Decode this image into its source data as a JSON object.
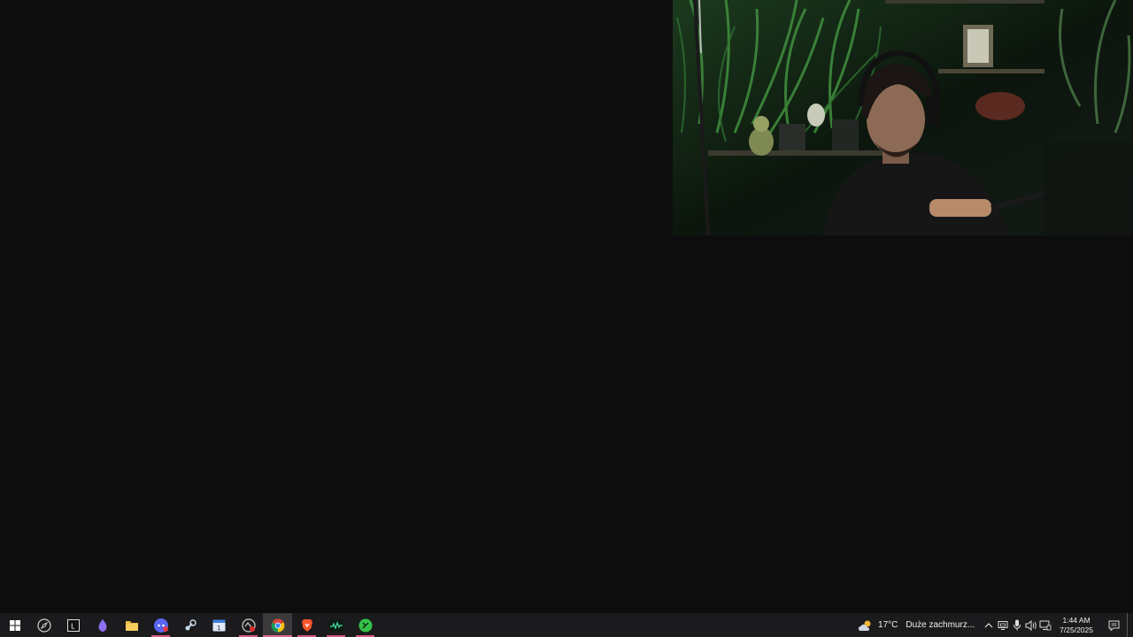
{
  "taskbar": {
    "apps": [
      {
        "name": "start-button",
        "icon": "windows-logo-icon",
        "active": false,
        "running": false
      },
      {
        "name": "taskbar-app-widget",
        "icon": "compass-icon",
        "active": false,
        "running": false
      },
      {
        "name": "taskbar-app-terminal",
        "icon": "terminal-icon",
        "active": false,
        "running": false
      },
      {
        "name": "taskbar-app-purple-drop",
        "icon": "drop-icon",
        "active": false,
        "running": false
      },
      {
        "name": "taskbar-app-file-explorer",
        "icon": "folder-icon",
        "active": false,
        "running": false
      },
      {
        "name": "taskbar-app-discord",
        "icon": "discord-icon",
        "active": false,
        "running": true
      },
      {
        "name": "taskbar-app-steam",
        "icon": "steam-icon",
        "active": false,
        "running": false
      },
      {
        "name": "taskbar-app-calendar",
        "icon": "calendar-icon",
        "active": false,
        "running": false
      },
      {
        "name": "taskbar-app-recorder",
        "icon": "recorder-icon",
        "active": false,
        "running": true
      },
      {
        "name": "taskbar-app-chrome",
        "icon": "chrome-icon",
        "active": true,
        "running": true
      },
      {
        "name": "taskbar-app-brave",
        "icon": "brave-icon",
        "active": false,
        "running": true
      },
      {
        "name": "taskbar-app-audio-monitor",
        "icon": "waveform-icon",
        "active": false,
        "running": true
      },
      {
        "name": "taskbar-app-green-app",
        "icon": "green-circle-icon",
        "active": false,
        "running": true
      }
    ],
    "weather": {
      "icon": "cloudy-sun-icon",
      "temperature": "17°C",
      "description": "Duże zachmurz..."
    },
    "tray_icons": [
      "chevron-up-icon",
      "display-icon",
      "microphone-icon",
      "speaker-icon",
      "network-icon"
    ],
    "clock": {
      "time": "1:44 AM",
      "date": "7/25/2025"
    },
    "notification_icon": "notification-icon"
  },
  "colors": {
    "desktop_bg": "#0d0d0e",
    "taskbar_bg": "#1b1b1d",
    "running_indicator": "#d85a83"
  }
}
